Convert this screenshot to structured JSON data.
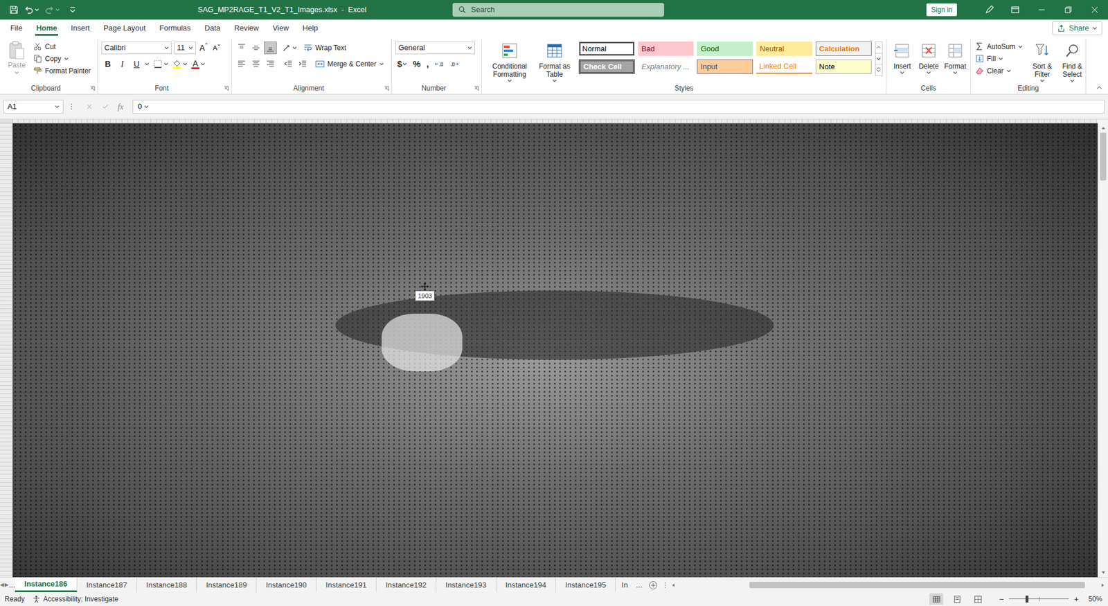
{
  "window": {
    "title": "SAG_MP2RAGE_T1_V2_T1_Images.xlsx  -  Excel"
  },
  "search": {
    "placeholder": "Search"
  },
  "sign_in": "Sign in",
  "menu_tabs": [
    {
      "label": "File",
      "selected": false
    },
    {
      "label": "Home",
      "selected": true
    },
    {
      "label": "Insert",
      "selected": false
    },
    {
      "label": "Page Layout",
      "selected": false
    },
    {
      "label": "Formulas",
      "selected": false
    },
    {
      "label": "Data",
      "selected": false
    },
    {
      "label": "Review",
      "selected": false
    },
    {
      "label": "View",
      "selected": false
    },
    {
      "label": "Help",
      "selected": false
    }
  ],
  "share": "Share",
  "ribbon": {
    "clipboard": {
      "label": "Clipboard",
      "paste": {
        "label": "Paste",
        "disabled": true
      },
      "items": [
        "Cut",
        "Copy",
        "Format Painter"
      ]
    },
    "font": {
      "label": "Font",
      "name": "Calibri",
      "size": "11",
      "grow": "A",
      "shrink": "A",
      "styles": [
        "B",
        "I",
        "U"
      ],
      "font_color": "A"
    },
    "alignment": {
      "label": "Alignment",
      "vertical": [
        {
          "selected": false
        },
        {
          "selected": false
        },
        {
          "selected": true
        }
      ],
      "wrap": "Wrap Text",
      "merge": "Merge & Center"
    },
    "number": {
      "label": "Number",
      "format": "General",
      "buttons": [
        "$",
        "%",
        ","
      ]
    },
    "styles": {
      "label": "Styles",
      "conditional": "Conditional Formatting",
      "table": "Format as Table",
      "cells": [
        {
          "label": "Normal",
          "kind": "normal",
          "color": "#ffffff",
          "text_color": "#000000",
          "selected": true
        },
        {
          "label": "Bad",
          "kind": "bad",
          "color": "#ffc7ce",
          "text_color": "#9c0006",
          "selected": false
        },
        {
          "label": "Good",
          "kind": "good",
          "color": "#c6efce",
          "text_color": "#006100",
          "selected": false
        },
        {
          "label": "Neutral",
          "kind": "neutral",
          "color": "#ffeb9c",
          "text_color": "#9c5700",
          "selected": false
        },
        {
          "label": "Calculation",
          "kind": "calculation",
          "color": "#f2f2f2",
          "text_color": "#fa7d00",
          "selected": false
        },
        {
          "label": "Check Cell",
          "kind": "check",
          "color": "#a5a5a5",
          "text_color": "#ffffff",
          "selected": false
        },
        {
          "label": "Explanatory ...",
          "kind": "explanatory",
          "color": "#ffffff",
          "text_color": "#7f7f7f",
          "selected": false
        },
        {
          "label": "Input",
          "kind": "input",
          "color": "#ffcc99",
          "text_color": "#3f3f76",
          "selected": false
        },
        {
          "label": "Linked Cell",
          "kind": "linked",
          "color": "#ffffff",
          "text_color": "#fa7d00",
          "selected": false
        },
        {
          "label": "Note",
          "kind": "note",
          "color": "#ffffcc",
          "text_color": "#000000",
          "selected": false
        }
      ]
    },
    "cells": {
      "label": "Cells",
      "buttons": [
        "Insert",
        "Delete",
        "Format"
      ]
    },
    "editing": {
      "label": "Editing",
      "items": [
        "AutoSum",
        "Fill",
        "Clear"
      ],
      "buttons": [
        "Sort & Filter",
        "Find & Select"
      ]
    }
  },
  "formula_bar": {
    "name_box": "A1",
    "fx": "fx",
    "value": "0"
  },
  "sheet": {
    "tooltip": "1903",
    "vscroll": {
      "offset": 0.0,
      "size": 0.11
    }
  },
  "sheet_tabs": {
    "prev": "◀",
    "next": "▶",
    "more_left": "...",
    "tabs": [
      {
        "label": "Instance186",
        "selected": true
      },
      {
        "label": "Instance187",
        "selected": false
      },
      {
        "label": "Instance188",
        "selected": false
      },
      {
        "label": "Instance189",
        "selected": false
      },
      {
        "label": "Instance190",
        "selected": false
      },
      {
        "label": "Instance191",
        "selected": false
      },
      {
        "label": "Instance192",
        "selected": false
      },
      {
        "label": "Instance193",
        "selected": false
      },
      {
        "label": "Instance194",
        "selected": false
      },
      {
        "label": "Instance195",
        "selected": false
      }
    ],
    "truncated": "In",
    "more_right": "...",
    "hscroll": {
      "offset": 0.17,
      "size": 0.8
    }
  },
  "status_bar": {
    "ready": "Ready",
    "accessibility": "Accessibility: Investigate",
    "views": [
      {
        "selected": true
      },
      {
        "selected": false
      },
      {
        "selected": false
      }
    ],
    "zoom_out": "−",
    "zoom_in": "+",
    "zoom": {
      "level": 0.3,
      "reading": "50%"
    }
  }
}
